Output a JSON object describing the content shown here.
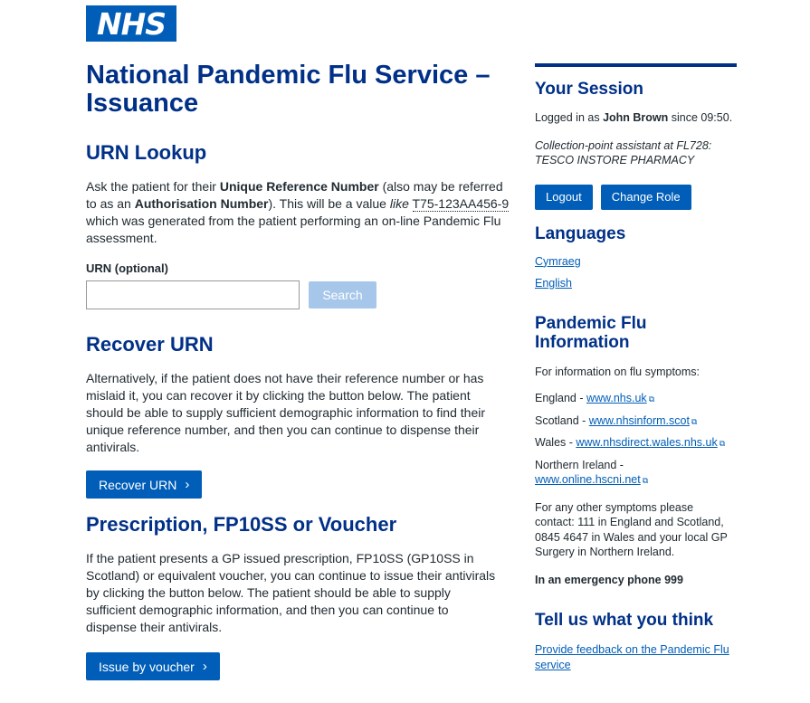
{
  "logo": {
    "text": "NHS"
  },
  "page_title": "National Pandemic Flu Service – Issuance",
  "urn_lookup": {
    "heading": "URN Lookup",
    "intro_1": "Ask the patient for their ",
    "intro_bold_1": "Unique Reference Number",
    "intro_2": " (also may be referred to as an ",
    "intro_bold_2": "Authorisation Number",
    "intro_3": "). This will be a value ",
    "intro_like": "like",
    "intro_example": "T75-123AA456-9",
    "intro_4": " which was generated from the patient performing an on-line Pandemic Flu assessment.",
    "field_label": "URN (optional)",
    "field_value": "",
    "search_label": "Search"
  },
  "recover": {
    "heading": "Recover URN",
    "text": "Alternatively, if the patient does not have their reference number or has mislaid it, you can recover it by clicking the button below. The patient should be able to supply sufficient demographic information to find their unique reference number, and then you can continue to dispense their antivirals.",
    "button_label": "Recover URN"
  },
  "voucher": {
    "heading": "Prescription, FP10SS or Voucher",
    "text": "If the patient presents a GP issued prescription, FP10SS (GP10SS in Scotland) or equivalent voucher, you can continue to issue their antivirals by clicking the button below. The patient should be able to supply sufficient demographic information, and then you can continue to dispense their antivirals.",
    "button_label": "Issue by voucher"
  },
  "session": {
    "heading": "Your Session",
    "logged_prefix": "Logged in as ",
    "user": "John Brown",
    "since": " since 09:50.",
    "role": "Collection-point assistant at FL728: TESCO INSTORE PHARMACY",
    "logout": "Logout",
    "change_role": "Change Role"
  },
  "languages": {
    "heading": "Languages",
    "items": [
      "Cymraeg",
      "English"
    ]
  },
  "flu_info": {
    "heading": "Pandemic Flu Information",
    "intro": "For information on flu symptoms:",
    "england_label": "England - ",
    "england_link": "www.nhs.uk",
    "scotland_label": "Scotland - ",
    "scotland_link": "www.nhsinform.scot",
    "wales_label": "Wales - ",
    "wales_link": "www.nhsdirect.wales.nhs.uk",
    "ni_label": "Northern Ireland - ",
    "ni_link": "www.online.hscni.net",
    "other": "For any other symptoms please contact: 111 in England and Scotland, 0845 4647 in Wales and your local GP Surgery in Northern Ireland.",
    "emergency": "In an emergency phone 999"
  },
  "feedback": {
    "heading": "Tell us what you think",
    "link": "Provide feedback on the Pandemic Flu service"
  },
  "colors": {
    "nhs_blue": "#005eb8",
    "dark_blue": "#003087"
  }
}
